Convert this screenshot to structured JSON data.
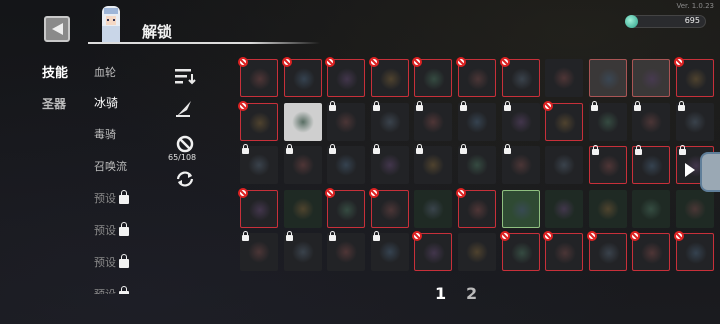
{
  "header": {
    "title": "解锁",
    "version": "Ver. 1.0.23",
    "currency_value": "695",
    "currency_icon": "gem-icon"
  },
  "tabs": [
    {
      "label": "技能",
      "active": true
    },
    {
      "label": "圣器",
      "active": false
    }
  ],
  "subcategories": [
    {
      "label": "血轮",
      "locked": false,
      "active": false
    },
    {
      "label": "冰骑",
      "locked": false,
      "active": true
    },
    {
      "label": "毒骑",
      "locked": false,
      "active": false
    },
    {
      "label": "召唤流",
      "locked": false,
      "active": false
    },
    {
      "label": "预设",
      "locked": true,
      "active": false
    },
    {
      "label": "预设",
      "locked": true,
      "active": false
    },
    {
      "label": "预设",
      "locked": true,
      "active": false
    },
    {
      "label": "预设",
      "locked": true,
      "active": false
    }
  ],
  "controls": {
    "sort_icon": "sort-icon",
    "edit_icon": "quill-icon",
    "ban_icon": "ban-icon",
    "ban_count": "65/108",
    "refresh_icon": "refresh-icon"
  },
  "pagination": {
    "pages": [
      "1",
      "2"
    ],
    "current": "1"
  },
  "colors": {
    "ban_red": "#c8303a",
    "accent_green": "#2a9f88"
  },
  "skill_grid": [
    [
      "red-ban",
      "red-ban",
      "red-ban",
      "red-ban",
      "red-ban",
      "red-ban",
      "red-ban",
      "plain",
      "sel",
      "sel",
      "red-ban"
    ],
    [
      "red-ban",
      "lite",
      "lock",
      "lock",
      "lock",
      "lock",
      "lock",
      "red-ban",
      "lock",
      "lock",
      "lock"
    ],
    [
      "lock",
      "lock",
      "lock",
      "lock",
      "lock",
      "lock",
      "lock",
      "plain",
      "red-lock",
      "red-lock",
      "red-lock"
    ],
    [
      "red-ban",
      "green",
      "red-ban",
      "red-ban",
      "green",
      "red-ban",
      "greenlite",
      "green",
      "green",
      "green",
      "green"
    ],
    [
      "lock",
      "lock",
      "lock",
      "lock",
      "red-ban",
      "plain",
      "red-ban",
      "red-ban",
      "red-ban",
      "red-ban",
      "red-ban"
    ]
  ]
}
